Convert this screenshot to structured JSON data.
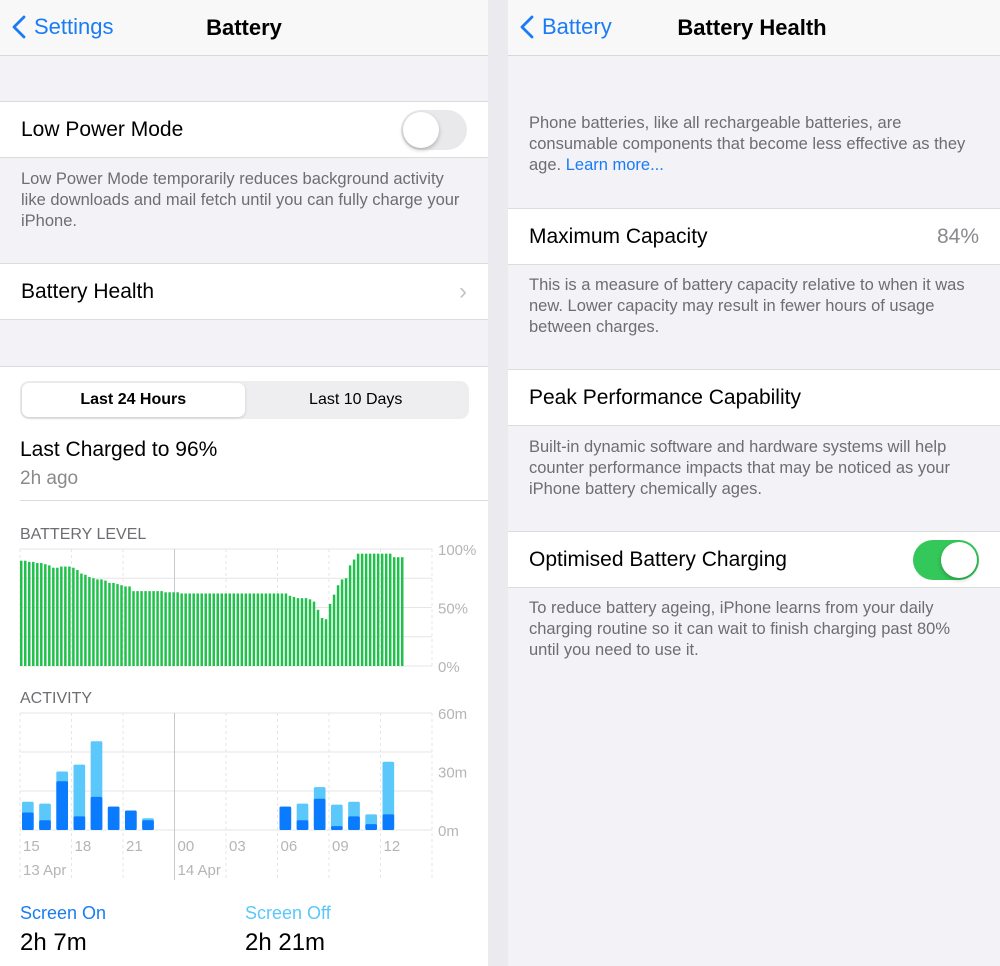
{
  "left": {
    "nav": {
      "back_label": "Settings",
      "title": "Battery"
    },
    "low_power": {
      "label": "Low Power Mode",
      "enabled": false,
      "footer": "Low Power Mode temporarily reduces background activity like downloads and mail fetch until you can fully charge your iPhone."
    },
    "battery_health": {
      "label": "Battery Health"
    },
    "segments": [
      "Last 24 Hours",
      "Last 10 Days"
    ],
    "selected_segment": "Last 24 Hours",
    "last_charged": "Last Charged to 96%",
    "last_charged_ago": "2h ago",
    "battery_level": {
      "label": "BATTERY LEVEL",
      "y_ticks": [
        "100%",
        "50%",
        "0%"
      ],
      "color": "#1ec24a",
      "levels": [
        90,
        90,
        89,
        89,
        88,
        88,
        87,
        86,
        84,
        84,
        85,
        85,
        85,
        84,
        82,
        79,
        78,
        76,
        75,
        74,
        74,
        73,
        71,
        71,
        70,
        69,
        68,
        68,
        64,
        64,
        64,
        64,
        64,
        64,
        64,
        64,
        63,
        63,
        63,
        63,
        62,
        62,
        62,
        62,
        62,
        62,
        62,
        62,
        62,
        62,
        62,
        62,
        62,
        62,
        62,
        62,
        62,
        62,
        62,
        62,
        62,
        62,
        62,
        62,
        62,
        62,
        62,
        60,
        59,
        58,
        58,
        58,
        57,
        55,
        48,
        41,
        40,
        53,
        61,
        69,
        74,
        75,
        86,
        91,
        96,
        96,
        96,
        96,
        96,
        96,
        96,
        96,
        96,
        93,
        93,
        93
      ]
    },
    "activity": {
      "label": "ACTIVITY",
      "y_ticks": [
        "60m",
        "30m",
        "0m"
      ],
      "screen_on_color": "#0a7aff",
      "screen_off_color": "#5ac8fa",
      "hours": [
        15,
        16,
        17,
        18,
        19,
        20,
        21,
        22,
        23,
        0,
        1,
        2,
        3,
        4,
        5,
        6,
        7,
        8,
        9,
        10,
        11,
        12,
        13,
        14
      ],
      "screen_on_min": [
        9,
        5,
        25,
        7,
        17,
        12,
        10,
        5,
        0,
        0,
        0,
        0,
        0,
        0,
        0,
        12,
        5,
        16,
        2,
        7,
        3,
        8,
        0,
        0
      ],
      "total_min": [
        14.5,
        13.5,
        30,
        33.5,
        45.5,
        12,
        10,
        6,
        0,
        0,
        0,
        0,
        0,
        0,
        0,
        12,
        13.5,
        22,
        13,
        14.5,
        8,
        35,
        0,
        0
      ],
      "x_ticks": [
        "15",
        "18",
        "21",
        "00",
        "03",
        "06",
        "09",
        "12"
      ],
      "dates": [
        "13 Apr",
        "14 Apr"
      ]
    },
    "screen_on": {
      "label": "Screen On",
      "value": "2h 7m"
    },
    "screen_off": {
      "label": "Screen Off",
      "value": "2h 21m"
    }
  },
  "right": {
    "nav": {
      "back_label": "Battery",
      "title": "Battery Health"
    },
    "intro": "Phone batteries, like all rechargeable batteries, are consumable components that become less effective as they age.",
    "learn_more": "Learn more...",
    "max_capacity": {
      "label": "Maximum Capacity",
      "value": "84%",
      "footer": "This is a measure of battery capacity relative to when it was new. Lower capacity may result in fewer hours of usage between charges."
    },
    "peak": {
      "label": "Peak Performance Capability",
      "footer": "Built-in dynamic software and hardware systems will help counter performance impacts that may be noticed as your iPhone battery chemically ages."
    },
    "optimised": {
      "label": "Optimised Battery Charging",
      "enabled": true,
      "footer": "To reduce battery ageing, iPhone learns from your daily charging routine so it can wait to finish charging past 80% until you need to use it."
    }
  }
}
